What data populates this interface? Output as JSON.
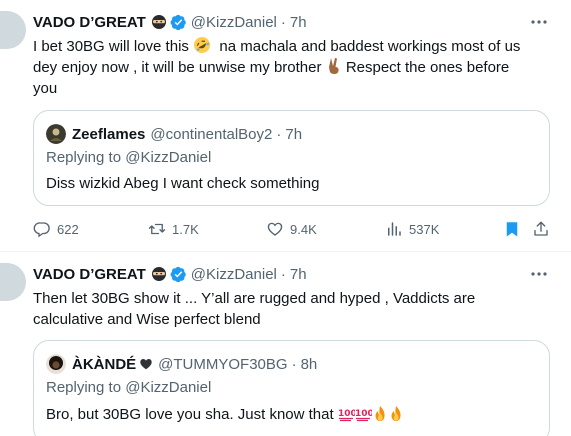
{
  "tweets": [
    {
      "author_name": "VADO D’GREAT",
      "author_handle": "@KizzDaniel",
      "time": "7h",
      "text_line1": "I bet 30BG will love this",
      "text_line1b": "na machala and baddest workings most of us",
      "text_line2": "dey enjoy now , it will be unwise my brother",
      "text_line2b": "Respect the ones before",
      "text_line3": "you",
      "quote": {
        "name": "Zeeflames",
        "handle": "@continentalBoy2",
        "time": "7h",
        "replying_prefix": "Replying to",
        "replying_handle": "@KizzDaniel",
        "text": "Diss wizkid Abeg I want check something"
      },
      "stats": {
        "replies": "622",
        "retweets": "1.7K",
        "likes": "9.4K",
        "views": "537K"
      }
    },
    {
      "author_name": "VADO D’GREAT",
      "author_handle": "@KizzDaniel",
      "time": "7h",
      "text_line1": "Then let 30BG show it ... Y’all are rugged and hyped , Vaddicts are",
      "text_line2": "calculative and Wise perfect blend",
      "quote": {
        "name": "ÀKÀNDÉ",
        "handle": "@TUMMYOF30BG",
        "time": "8h",
        "replying_prefix": "Replying to",
        "replying_handle": "@KizzDaniel",
        "text": "Bro, but 30BG love you sha. Just know that"
      }
    }
  ],
  "separator": "·",
  "icons": {
    "reply": "reply-icon",
    "retweet": "retweet-icon",
    "like": "heart-icon",
    "views": "views-icon",
    "bookmark": "bookmark-icon",
    "share": "share-icon",
    "more": "more-icon",
    "verified": "verified-badge-icon",
    "ninja": "ninja-emoji-icon"
  },
  "colors": {
    "text": "#0f1419",
    "secondary": "#536471",
    "verified": "#1d9bf0",
    "bookmark": "#1d9bf0",
    "border": "#cfd9de"
  }
}
